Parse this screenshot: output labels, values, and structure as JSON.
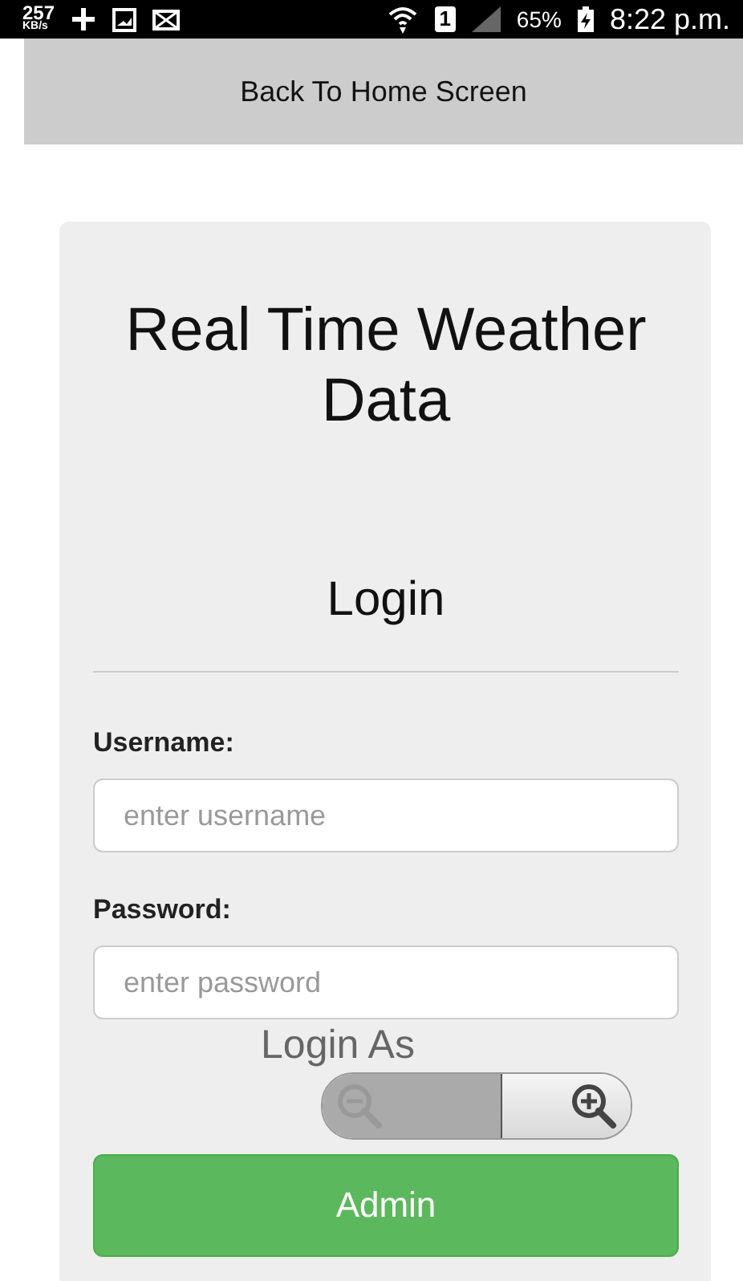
{
  "status_bar": {
    "speed": "257",
    "speed_unit": "KB/s",
    "sim": "1",
    "battery": "65%",
    "time": "8:22 p.m."
  },
  "header": {
    "back_link": "Back To Home Screen"
  },
  "card": {
    "title": "Real Time Weather Data",
    "subtitle": "Login",
    "fields": [
      {
        "label": "Username:",
        "placeholder": "enter username"
      },
      {
        "label": "Password:",
        "placeholder": "enter password"
      }
    ],
    "login_as": "Login As",
    "buttons": [
      "Admin"
    ]
  },
  "zoom_control": {
    "zoom_out_disabled": true,
    "zoom_in_disabled": false
  }
}
